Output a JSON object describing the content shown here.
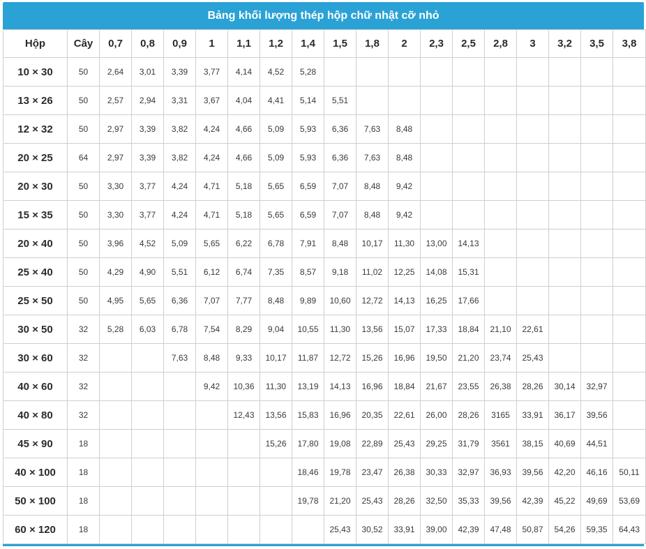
{
  "title": "Bảng khối lượng thép hộp chữ nhật cỡ nhỏ",
  "headers": [
    "Hộp",
    "Cây",
    "0,7",
    "0,8",
    "0,9",
    "1",
    "1,1",
    "1,2",
    "1,4",
    "1,5",
    "1,8",
    "2",
    "2,3",
    "2,5",
    "2,8",
    "3",
    "3,2",
    "3,5",
    "3,8"
  ],
  "rows": [
    {
      "size": "10 × 30",
      "cay": "50",
      "values": [
        "2,64",
        "3,01",
        "3,39",
        "3,77",
        "4,14",
        "4,52",
        "5,28",
        "",
        "",
        "",
        "",
        "",
        "",
        "",
        "",
        "",
        ""
      ]
    },
    {
      "size": "13 × 26",
      "cay": "50",
      "values": [
        "2,57",
        "2,94",
        "3,31",
        "3,67",
        "4,04",
        "4,41",
        "5,14",
        "5,51",
        "",
        "",
        "",
        "",
        "",
        "",
        "",
        "",
        ""
      ]
    },
    {
      "size": "12 × 32",
      "cay": "50",
      "values": [
        "2,97",
        "3,39",
        "3,82",
        "4,24",
        "4,66",
        "5,09",
        "5,93",
        "6,36",
        "7,63",
        "8,48",
        "",
        "",
        "",
        "",
        "",
        "",
        ""
      ]
    },
    {
      "size": "20 × 25",
      "cay": "64",
      "values": [
        "2,97",
        "3,39",
        "3,82",
        "4,24",
        "4,66",
        "5,09",
        "5,93",
        "6,36",
        "7,63",
        "8,48",
        "",
        "",
        "",
        "",
        "",
        "",
        ""
      ]
    },
    {
      "size": "20 × 30",
      "cay": "50",
      "values": [
        "3,30",
        "3,77",
        "4,24",
        "4,71",
        "5,18",
        "5,65",
        "6,59",
        "7,07",
        "8,48",
        "9,42",
        "",
        "",
        "",
        "",
        "",
        "",
        ""
      ]
    },
    {
      "size": "15 × 35",
      "cay": "50",
      "values": [
        "3,30",
        "3,77",
        "4,24",
        "4,71",
        "5,18",
        "5,65",
        "6,59",
        "7,07",
        "8,48",
        "9,42",
        "",
        "",
        "",
        "",
        "",
        "",
        ""
      ]
    },
    {
      "size": "20 × 40",
      "cay": "50",
      "values": [
        "3,96",
        "4,52",
        "5,09",
        "5,65",
        "6,22",
        "6,78",
        "7,91",
        "8,48",
        "10,17",
        "11,30",
        "13,00",
        "14,13",
        "",
        "",
        "",
        "",
        ""
      ]
    },
    {
      "size": "25 × 40",
      "cay": "50",
      "values": [
        "4,29",
        "4,90",
        "5,51",
        "6,12",
        "6,74",
        "7,35",
        "8,57",
        "9,18",
        "11,02",
        "12,25",
        "14,08",
        "15,31",
        "",
        "",
        "",
        "",
        ""
      ]
    },
    {
      "size": "25 × 50",
      "cay": "50",
      "values": [
        "4,95",
        "5,65",
        "6,36",
        "7,07",
        "7,77",
        "8,48",
        "9,89",
        "10,60",
        "12,72",
        "14,13",
        "16,25",
        "17,66",
        "",
        "",
        "",
        "",
        ""
      ]
    },
    {
      "size": "30 × 50",
      "cay": "32",
      "values": [
        "5,28",
        "6,03",
        "6,78",
        "7,54",
        "8,29",
        "9,04",
        "10,55",
        "11,30",
        "13,56",
        "15,07",
        "17,33",
        "18,84",
        "21,10",
        "22,61",
        "",
        "",
        ""
      ]
    },
    {
      "size": "30 × 60",
      "cay": "32",
      "values": [
        "",
        "",
        "7,63",
        "8,48",
        "9,33",
        "10,17",
        "11,87",
        "12,72",
        "15,26",
        "16,96",
        "19,50",
        "21,20",
        "23,74",
        "25,43",
        "",
        "",
        ""
      ]
    },
    {
      "size": "40 × 60",
      "cay": "32",
      "values": [
        "",
        "",
        "",
        "9,42",
        "10,36",
        "11,30",
        "13,19",
        "14,13",
        "16,96",
        "18,84",
        "21,67",
        "23,55",
        "26,38",
        "28,26",
        "30,14",
        "32,97",
        ""
      ]
    },
    {
      "size": "40 × 80",
      "cay": "32",
      "values": [
        "",
        "",
        "",
        "",
        "12,43",
        "13,56",
        "15,83",
        "16,96",
        "20,35",
        "22,61",
        "26,00",
        "28,26",
        "3165",
        "33,91",
        "36,17",
        "39,56",
        ""
      ]
    },
    {
      "size": "45 × 90",
      "cay": "18",
      "values": [
        "",
        "",
        "",
        "",
        "",
        "15,26",
        "17,80",
        "19,08",
        "22,89",
        "25,43",
        "29,25",
        "31,79",
        "3561",
        "38,15",
        "40,69",
        "44,51",
        ""
      ]
    },
    {
      "size": "40 × 100",
      "cay": "18",
      "values": [
        "",
        "",
        "",
        "",
        "",
        "",
        "18,46",
        "19,78",
        "23,47",
        "26,38",
        "30,33",
        "32,97",
        "36,93",
        "39,56",
        "42,20",
        "46,16",
        "50,11"
      ]
    },
    {
      "size": "50 × 100",
      "cay": "18",
      "values": [
        "",
        "",
        "",
        "",
        "",
        "",
        "19,78",
        "21,20",
        "25,43",
        "28,26",
        "32,50",
        "35,33",
        "39,56",
        "42,39",
        "45,22",
        "49,69",
        "53,69"
      ]
    },
    {
      "size": "60 × 120",
      "cay": "18",
      "values": [
        "",
        "",
        "",
        "",
        "",
        "",
        "",
        "25,43",
        "30,52",
        "33,91",
        "39,00",
        "42,39",
        "47,48",
        "50,87",
        "54,26",
        "59,35",
        "64,43"
      ]
    }
  ],
  "colors": {
    "header_bar": "#2aa2d5",
    "border": "#cfcfcf",
    "text": "#333333"
  }
}
